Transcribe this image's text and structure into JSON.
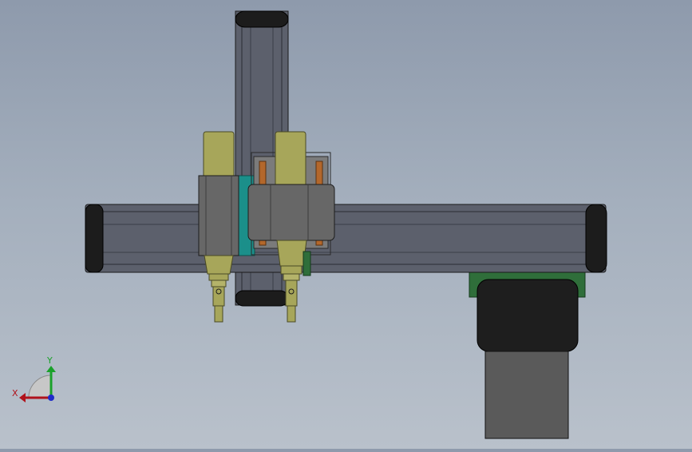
{
  "axes": {
    "x_label": "X",
    "y_label": "Y"
  },
  "colors": {
    "extrusion": "#5c606c",
    "endcap": "#1c1c1c",
    "cylinder": "#a7a65a",
    "carriage": "#676767",
    "pcb": "#2f6e3a",
    "teal": "#1b8f8a",
    "motor": "#1e1e1e",
    "motor_body": "#5a5a5a",
    "axis_x": "#b0121b",
    "axis_y": "#1aa12a"
  }
}
